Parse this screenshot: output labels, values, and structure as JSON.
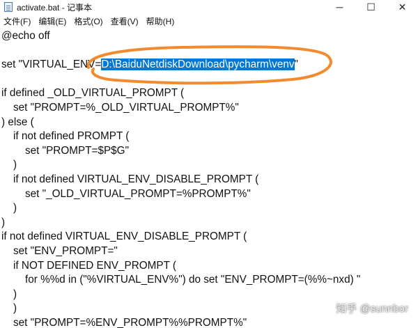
{
  "window": {
    "title": "activate.bat - 记事本",
    "controls": {
      "minimize": "─",
      "maximize": "☐",
      "close": "✕"
    }
  },
  "menu": [
    "文件(F)",
    "编辑(E)",
    "格式(O)",
    "查看(V)",
    "帮助(H)"
  ],
  "editor": {
    "lines": [
      {
        "segments": [
          {
            "text": "@echo off"
          }
        ]
      },
      {
        "segments": [
          {
            "text": ""
          }
        ]
      },
      {
        "segments": [
          {
            "text": "set \"VIRTUAL_ENV="
          },
          {
            "text": "D:\\BaiduNetdiskDownload\\pycharm\\venv",
            "selected": true
          },
          {
            "text": "\""
          }
        ]
      },
      {
        "segments": [
          {
            "text": ""
          }
        ]
      },
      {
        "segments": [
          {
            "text": "if defined _OLD_VIRTUAL_PROMPT ("
          }
        ]
      },
      {
        "segments": [
          {
            "text": "    set \"PROMPT=%_OLD_VIRTUAL_PROMPT%\""
          }
        ]
      },
      {
        "segments": [
          {
            "text": ") else ("
          }
        ]
      },
      {
        "segments": [
          {
            "text": "    if not defined PROMPT ("
          }
        ]
      },
      {
        "segments": [
          {
            "text": "        set \"PROMPT=$P$G\""
          }
        ]
      },
      {
        "segments": [
          {
            "text": "    )"
          }
        ]
      },
      {
        "segments": [
          {
            "text": "    if not defined VIRTUAL_ENV_DISABLE_PROMPT ("
          }
        ]
      },
      {
        "segments": [
          {
            "text": "        set \"_OLD_VIRTUAL_PROMPT=%PROMPT%\""
          }
        ]
      },
      {
        "segments": [
          {
            "text": "    )"
          }
        ]
      },
      {
        "segments": [
          {
            "text": ")"
          }
        ]
      },
      {
        "segments": [
          {
            "text": "if not defined VIRTUAL_ENV_DISABLE_PROMPT ("
          }
        ]
      },
      {
        "segments": [
          {
            "text": "    set \"ENV_PROMPT=\""
          }
        ]
      },
      {
        "segments": [
          {
            "text": "    if NOT DEFINED ENV_PROMPT ("
          }
        ]
      },
      {
        "segments": [
          {
            "text": "        for %%d in (\"%VIRTUAL_ENV%\") do set \"ENV_PROMPT=(%%~nxd) \""
          }
        ]
      },
      {
        "segments": [
          {
            "text": "    )"
          }
        ]
      },
      {
        "segments": [
          {
            "text": "    )"
          }
        ]
      },
      {
        "segments": [
          {
            "text": "    set \"PROMPT=%ENV_PROMPT%%PROMPT%\""
          }
        ]
      }
    ]
  },
  "annotation": {
    "color": "#f28b30"
  },
  "watermark": {
    "text": "知乎 @sunnbor"
  },
  "colors": {
    "selection": "#0078d7",
    "selection_text": "#ffffff",
    "text": "#111111"
  }
}
